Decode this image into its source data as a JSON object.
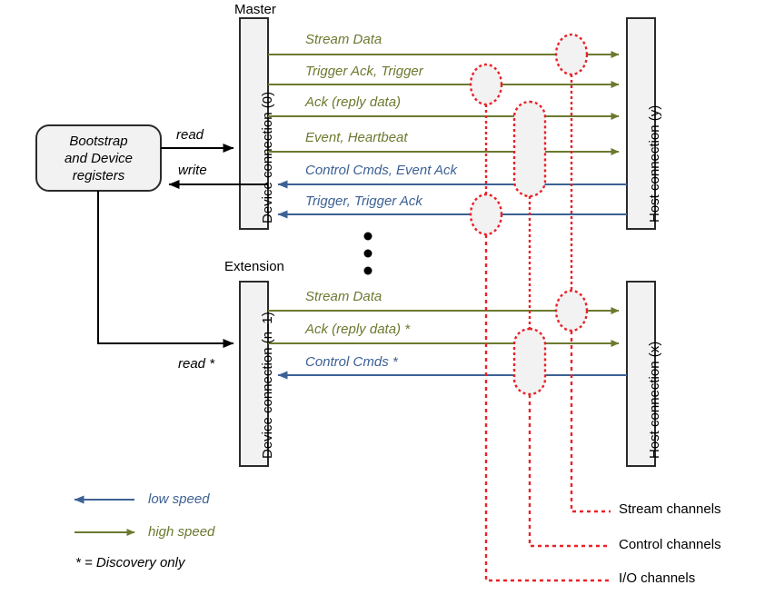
{
  "diagram": {
    "title_master": "Master",
    "title_extension": "Extension",
    "registers_box": {
      "line1": "Bootstrap",
      "line2": "and Device",
      "line3": "registers"
    },
    "device_master_label": "Device connection (0)",
    "device_ext_label": "Device connection (n–1)",
    "host_master_label": "Host connection (y)",
    "host_ext_label": "Host connection (x)",
    "reg_arrows": {
      "read": "read",
      "write": "write",
      "read_star": "read *"
    },
    "master_flows": [
      {
        "text": "Stream Data",
        "speed": "high",
        "dir": "right"
      },
      {
        "text": "Trigger Ack, Trigger",
        "speed": "high",
        "dir": "right"
      },
      {
        "text": "Ack (reply data)",
        "speed": "high",
        "dir": "right"
      },
      {
        "text": "Event, Heartbeat",
        "speed": "high",
        "dir": "right"
      },
      {
        "text": "Control Cmds, Event Ack",
        "speed": "low",
        "dir": "left"
      },
      {
        "text": "Trigger, Trigger Ack",
        "speed": "low",
        "dir": "left"
      }
    ],
    "extension_flows": [
      {
        "text": "Stream Data",
        "speed": "high",
        "dir": "right"
      },
      {
        "text": "Ack (reply data) *",
        "speed": "high",
        "dir": "right"
      },
      {
        "text": "Control Cmds *",
        "speed": "low",
        "dir": "left"
      }
    ],
    "channel_legend": [
      {
        "name": "Stream channels"
      },
      {
        "name": "Control channels"
      },
      {
        "name": "I/O channels"
      }
    ],
    "legend": {
      "low_speed": "low speed",
      "high_speed": "high speed",
      "discovery": "* = Discovery only"
    },
    "ellipsis_dots": "• • •",
    "colors": {
      "high_speed": "#6b7a2f",
      "low_speed": "#3d6194",
      "channel": "#e8232a",
      "box_fill": "#f2f2f2",
      "box_stroke": "#2b2b2b"
    }
  }
}
